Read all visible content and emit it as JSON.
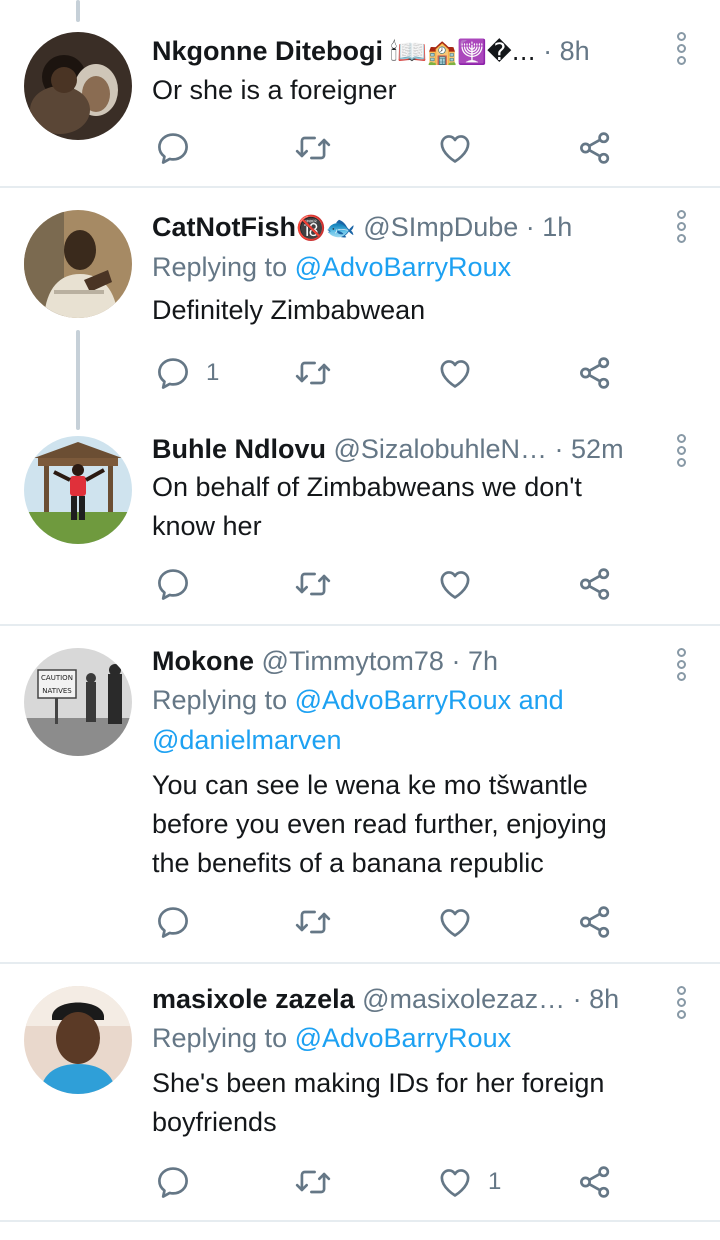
{
  "tweets": [
    {
      "name": "Nkgonne Ditebogi",
      "name_emoji": "🕯📖🏫🕎�…",
      "handle": "",
      "time": "· 8h",
      "reply_prefix": "",
      "reply_to": "",
      "text_lines": [
        "Or she is a foreigner"
      ],
      "reply_count": "",
      "like_count": ""
    },
    {
      "name": "CatNotFish",
      "name_emoji": "🔞🐟",
      "handle": "@SImpDube",
      "time": "· 1h",
      "reply_prefix": "Replying to ",
      "reply_to": "@AdvoBarryRoux",
      "text_lines": [
        "Definitely Zimbabwean"
      ],
      "reply_count": "1",
      "like_count": ""
    },
    {
      "name": "Buhle Ndlovu",
      "name_emoji": "",
      "handle": "@SizalobuhleN…",
      "time": "· 52m",
      "reply_prefix": "",
      "reply_to": "",
      "text_lines": [
        "On behalf of Zimbabweans we don't",
        "know her"
      ],
      "reply_count": "",
      "like_count": ""
    },
    {
      "name": "Mokone",
      "name_emoji": "",
      "handle": "@Timmytom78",
      "time": "· 7h",
      "reply_prefix": "Replying to ",
      "reply_to": "@AdvoBarryRoux and",
      "reply_to_2": "@danielmarven",
      "text_lines": [
        "You can see le wena ke mo tšwantle",
        "before you even read further, enjoying",
        "the benefits of a banana republic"
      ],
      "reply_count": "",
      "like_count": "",
      "avatar_sign": [
        "CAUTION",
        "NATIVES"
      ]
    },
    {
      "name": "masixole zazela",
      "name_emoji": "",
      "handle": "@masixolezaz…",
      "time": "· 8h",
      "reply_prefix": "Replying to ",
      "reply_to": "@AdvoBarryRoux",
      "text_lines": [
        "She's been making IDs for her foreign",
        "boyfriends"
      ],
      "reply_count": "",
      "like_count": "1"
    }
  ],
  "colors": {
    "accent": "#1da1f2",
    "secondary_text": "#657786",
    "divider": "#e6ecf0",
    "thread_line": "#c6d0d8"
  },
  "icons": [
    "reply-icon",
    "retweet-icon",
    "like-icon",
    "share-icon",
    "more-options-icon"
  ]
}
